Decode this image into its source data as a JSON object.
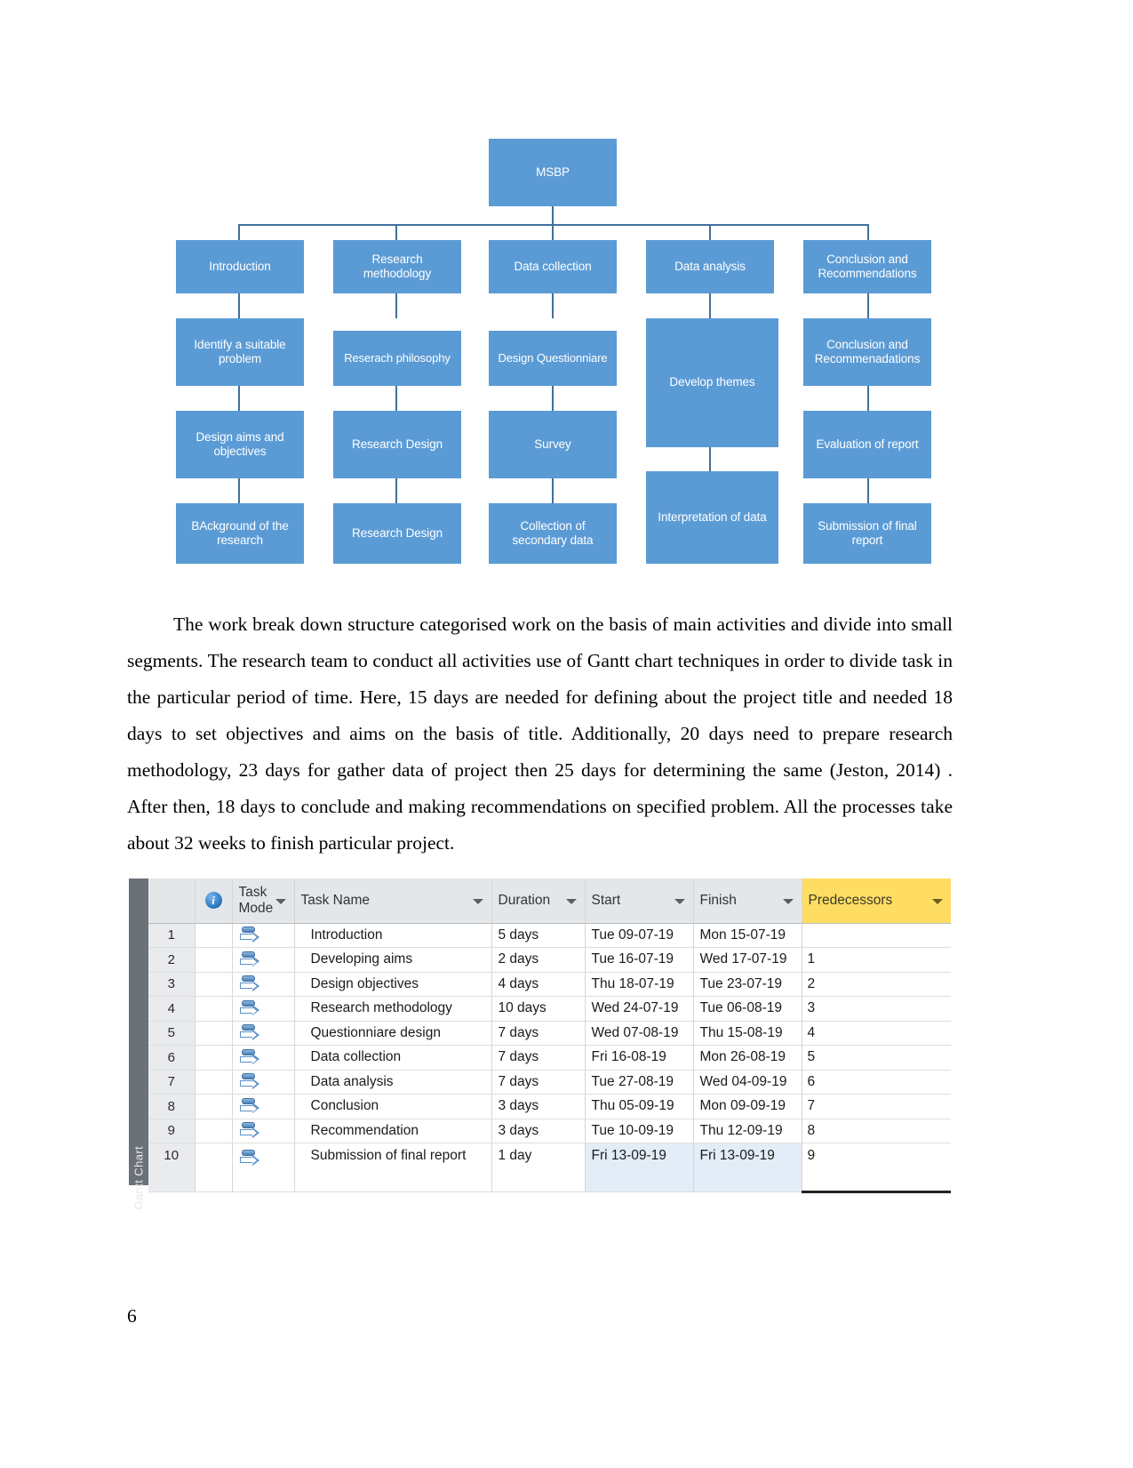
{
  "document": {
    "page_number": "6"
  },
  "wbs": {
    "root": {
      "label": "MSBP"
    },
    "columns": [
      {
        "level1": "Introduction",
        "nodes": [
          "Identify a suitable problem",
          "Design aims and objectives",
          "BAckground of the research"
        ]
      },
      {
        "level1": "Research methodology",
        "nodes": [
          "Reserach philosophy",
          "Research Design",
          "Research Design"
        ]
      },
      {
        "level1": "Data collection",
        "nodes": [
          "Design Questionniare",
          "Survey",
          "Collection of secondary data"
        ]
      },
      {
        "level1": "Data analysis",
        "nodes": [
          "Develop themes",
          "Interpretation of data"
        ]
      },
      {
        "level1": "Conclusion and Recommendations",
        "nodes": [
          "Conclusion and Recommenadations",
          "Evaluation of report",
          "Submission of final report"
        ]
      }
    ],
    "colors": {
      "box_fill": "#5b9bd5",
      "connector": "#41719c",
      "text": "#ffffff"
    }
  },
  "paragraph": {
    "text": "The work break down structure categorised work on the basis of main activities and divide into small segments. The research team to conduct all activities use of Gantt chart techniques in order to divide task in the particular period of time. Here, 15 days are needed for defining about the project title and needed 18 days to set objectives and aims on the basis of title. Additionally, 20 days need to prepare research methodology, 23 days for gather data of project then 25  days for determining the same (Jeston,  2014) . After then, 18 days to conclude and making recommendations on specified problem. All the processes take about 32 weeks to finish particular project."
  },
  "gantt": {
    "view_label": "Gantt Chart",
    "columns": [
      {
        "key": "num",
        "label": ""
      },
      {
        "key": "ind",
        "label": "",
        "icon": "info-icon"
      },
      {
        "key": "mode",
        "label": "Task Mode"
      },
      {
        "key": "name",
        "label": "Task Name"
      },
      {
        "key": "dur",
        "label": "Duration"
      },
      {
        "key": "start",
        "label": "Start"
      },
      {
        "key": "fin",
        "label": "Finish"
      },
      {
        "key": "pred",
        "label": "Predecessors",
        "highlight": "#ffdd63"
      }
    ],
    "rows": [
      {
        "num": "1",
        "name": "Introduction",
        "dur": "5 days",
        "start": "Tue 09-07-19",
        "fin": "Mon 15-07-19",
        "pred": ""
      },
      {
        "num": "2",
        "name": "Developing aims",
        "dur": "2 days",
        "start": "Tue 16-07-19",
        "fin": "Wed 17-07-19",
        "pred": "1"
      },
      {
        "num": "3",
        "name": "Design objectives",
        "dur": "4 days",
        "start": "Thu 18-07-19",
        "fin": "Tue 23-07-19",
        "pred": "2"
      },
      {
        "num": "4",
        "name": "Research methodology",
        "dur": "10 days",
        "start": "Wed 24-07-19",
        "fin": "Tue 06-08-19",
        "pred": "3"
      },
      {
        "num": "5",
        "name": "Questionniare design",
        "dur": "7 days",
        "start": "Wed 07-08-19",
        "fin": "Thu 15-08-19",
        "pred": "4"
      },
      {
        "num": "6",
        "name": "Data collection",
        "dur": "7 days",
        "start": "Fri 16-08-19",
        "fin": "Mon 26-08-19",
        "pred": "5"
      },
      {
        "num": "7",
        "name": "Data analysis",
        "dur": "7 days",
        "start": "Tue 27-08-19",
        "fin": "Wed 04-09-19",
        "pred": "6"
      },
      {
        "num": "8",
        "name": "Conclusion",
        "dur": "3 days",
        "start": "Thu 05-09-19",
        "fin": "Mon 09-09-19",
        "pred": "7"
      },
      {
        "num": "9",
        "name": "Recommendation",
        "dur": "3 days",
        "start": "Tue 10-09-19",
        "fin": "Thu 12-09-19",
        "pred": "8"
      },
      {
        "num": "10",
        "name": "Submission of final report",
        "dur": "1 day",
        "start": "Fri 13-09-19",
        "fin": "Fri 13-09-19",
        "pred": "9"
      }
    ]
  }
}
